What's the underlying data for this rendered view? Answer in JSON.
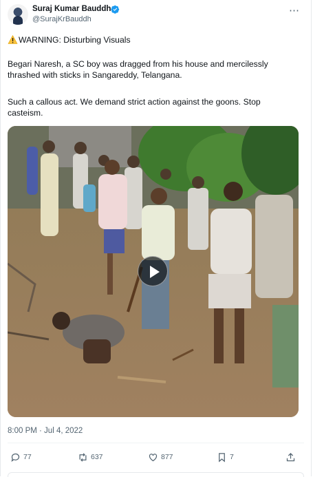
{
  "author": {
    "name": "Suraj Kumar Bauddh",
    "handle": "@SurajKrBauddh"
  },
  "tweet": {
    "warning": "WARNING: Disturbing Visuals",
    "line1": "Begari Naresh, a SC boy was dragged from his house and mercilessly",
    "line2": "thrashed with sticks in Sangareddy, Telangana.",
    "line3": "Such a callous act. We demand strict action against the goons. Stop",
    "line4": "casteism.",
    "timestamp": "8:00 PM · Jul 4, 2022"
  },
  "stats": {
    "replies": "77",
    "retweets": "637",
    "likes": "877",
    "bookmarks": "7"
  },
  "colors": {
    "text": "#0f1419",
    "secondary": "#536471",
    "verified": "#1d9bf0"
  },
  "icons": [
    "verified-icon",
    "more-icon",
    "warning-icon",
    "play-icon",
    "reply-icon",
    "retweet-icon",
    "like-icon",
    "bookmark-icon",
    "share-icon"
  ]
}
